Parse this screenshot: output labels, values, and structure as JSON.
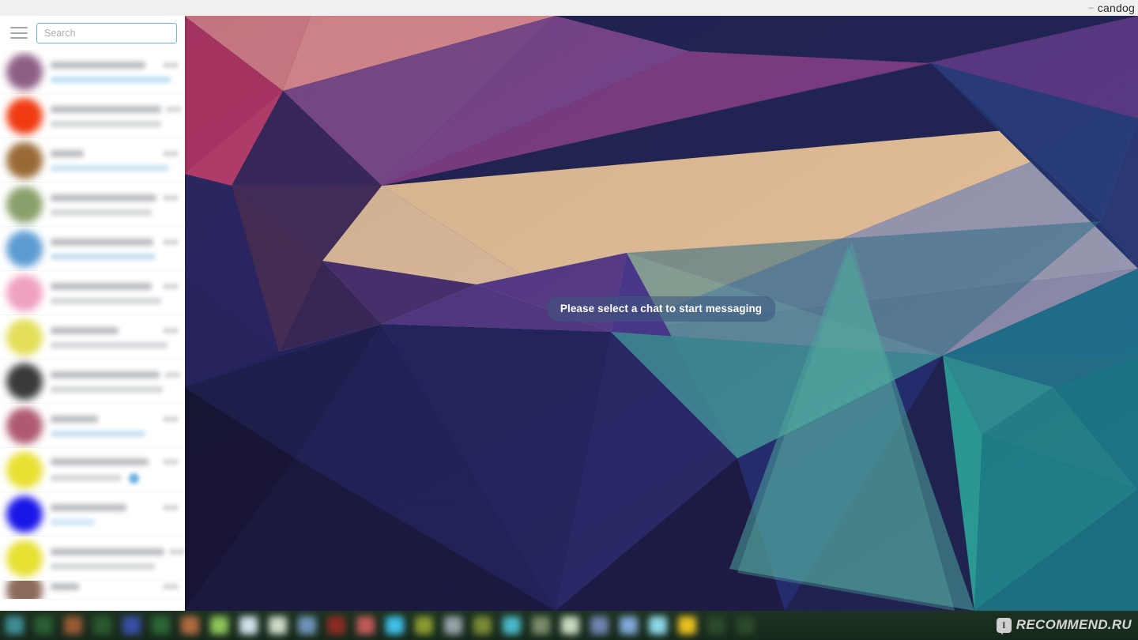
{
  "window": {
    "title": "candog",
    "minimize_glyph": "–"
  },
  "sidebar": {
    "menu_icon": "hamburger-menu-icon",
    "search": {
      "placeholder": "Search",
      "value": "",
      "border_color": "#6cb4e0",
      "focused": true
    },
    "chats_blurred": true,
    "items": [
      {
        "name": "",
        "preview": "",
        "time": "",
        "avatar_color": "#8e5f86",
        "name_w": 120,
        "msg_w": 152,
        "msg_color": "#bfe0f5",
        "badge": false,
        "badge_color": ""
      },
      {
        "name": "",
        "preview": "",
        "time": "",
        "avatar_color": "#f03b12",
        "name_w": 140,
        "msg_w": 140,
        "msg_color": "#d2d5d8",
        "badge": false,
        "badge_color": ""
      },
      {
        "name": "",
        "preview": "",
        "time": "",
        "avatar_color": "#9a6a36",
        "name_w": 42,
        "msg_w": 150,
        "msg_color": "#cfe4f2",
        "badge": false,
        "badge_color": ""
      },
      {
        "name": "",
        "preview": "",
        "time": "",
        "avatar_color": "#8aa06a",
        "name_w": 134,
        "msg_w": 128,
        "msg_color": "#d2d5d8",
        "badge": false,
        "badge_color": ""
      },
      {
        "name": "",
        "preview": "",
        "time": "",
        "avatar_color": "#5b9bd2",
        "name_w": 130,
        "msg_w": 133,
        "msg_color": "#c6dff0",
        "badge": false,
        "badge_color": ""
      },
      {
        "name": "",
        "preview": "",
        "time": "",
        "avatar_color": "#f0a0c0",
        "name_w": 128,
        "msg_w": 140,
        "msg_color": "#d2d5d8",
        "badge": false,
        "badge_color": ""
      },
      {
        "name": "",
        "preview": "",
        "time": "",
        "avatar_color": "#e3df58",
        "name_w": 86,
        "msg_w": 148,
        "msg_color": "#d2d5d8",
        "badge": false,
        "badge_color": ""
      },
      {
        "name": "",
        "preview": "",
        "time": "",
        "avatar_color": "#3a3a3a",
        "name_w": 138,
        "msg_w": 142,
        "msg_color": "#d2d5d8",
        "badge": false,
        "badge_color": ""
      },
      {
        "name": "",
        "preview": "",
        "time": "",
        "avatar_color": "#b05a72",
        "name_w": 60,
        "msg_w": 120,
        "msg_color": "#c9e2f4",
        "badge": false,
        "badge_color": ""
      },
      {
        "name": "",
        "preview": "",
        "time": "",
        "avatar_color": "#e8e030",
        "name_w": 124,
        "msg_w": 90,
        "msg_color": "#d2d5d8",
        "badge": true,
        "badge_color": "#6ab0e0"
      },
      {
        "name": "",
        "preview": "",
        "time": "",
        "avatar_color": "#1a16e8",
        "name_w": 96,
        "msg_w": 56,
        "msg_color": "#cfe6f7",
        "badge": false,
        "badge_color": ""
      },
      {
        "name": "",
        "preview": "",
        "time": "",
        "avatar_color": "#e6e030",
        "name_w": 144,
        "msg_w": 132,
        "msg_color": "#d2d5d8",
        "badge": false,
        "badge_color": ""
      },
      {
        "name": "",
        "preview": "",
        "time": "",
        "avatar_color": "#8d6b5c",
        "name_w": 36,
        "msg_w": 0,
        "msg_color": "#d2d5d8",
        "badge": false,
        "badge_color": ""
      }
    ]
  },
  "chat_pane": {
    "empty_state_text": "Please select a chat to start messaging",
    "wallpaper": "low-poly-geometric-triangles",
    "pill_bg": "rgba(62,86,127,0.58)"
  },
  "taskbar": {
    "background": "#1b2f20",
    "blurred": true,
    "icons": [
      "#3f8f96",
      "#2a5f33",
      "#9a5a33",
      "#2b5a2e",
      "#3a4fa8",
      "#2d6637",
      "#b06a40",
      "#8fc45a",
      "#cfe3ea",
      "#cfd8c8",
      "#6f94b8",
      "#8e2c24",
      "#c05a58",
      "#3fc0e8",
      "#8a9a30",
      "#98a3a8",
      "#7a8a34",
      "#49b8c8",
      "#7a8a6a",
      "#c8d8c0",
      "#6f84b0",
      "#7fa8d8",
      "#8fd8e8",
      "#e8c020",
      "#2b4a2c",
      "#2b4a2c"
    ]
  },
  "watermark": {
    "text": "RECOMMEND.RU",
    "logo_letter": "I"
  }
}
